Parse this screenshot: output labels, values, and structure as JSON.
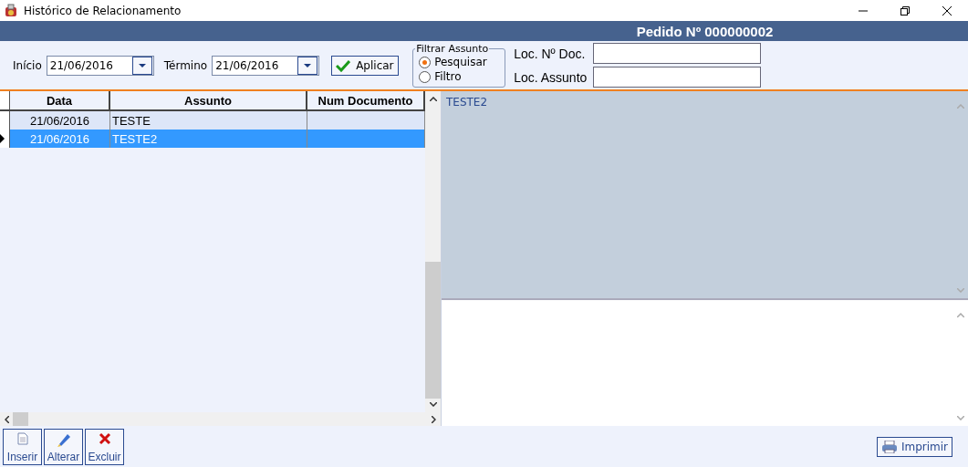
{
  "window": {
    "title": "Histórico de Relacionamento"
  },
  "header": {
    "title": "Pedido Nº 000000002"
  },
  "filters": {
    "start_label": "Início",
    "start_value": "21/06/2016",
    "end_label": "Término",
    "end_value": "21/06/2016",
    "apply_button": "Aplicar"
  },
  "subject_filter": {
    "legend": "Filtrar Assunto",
    "options": [
      {
        "label": "Pesquisar",
        "selected": true
      },
      {
        "label": "Filtro",
        "selected": false
      }
    ]
  },
  "search_fields": [
    {
      "label": "Loc. Nº Doc."
    },
    {
      "label": "Loc. Assunto"
    }
  ],
  "table": {
    "columns": [
      "Data",
      "Assunto",
      "Num Documento"
    ],
    "rows": [
      {
        "cells": [
          "21/06/2016",
          "TESTE",
          ""
        ],
        "selected": false
      },
      {
        "cells": [
          "21/06/2016",
          "TESTE2",
          ""
        ],
        "selected": true
      }
    ]
  },
  "detail_text": "TESTE2",
  "buttons": [
    "Inserir",
    "Alterar",
    "Excluir"
  ],
  "print_button": "Imprimir"
}
